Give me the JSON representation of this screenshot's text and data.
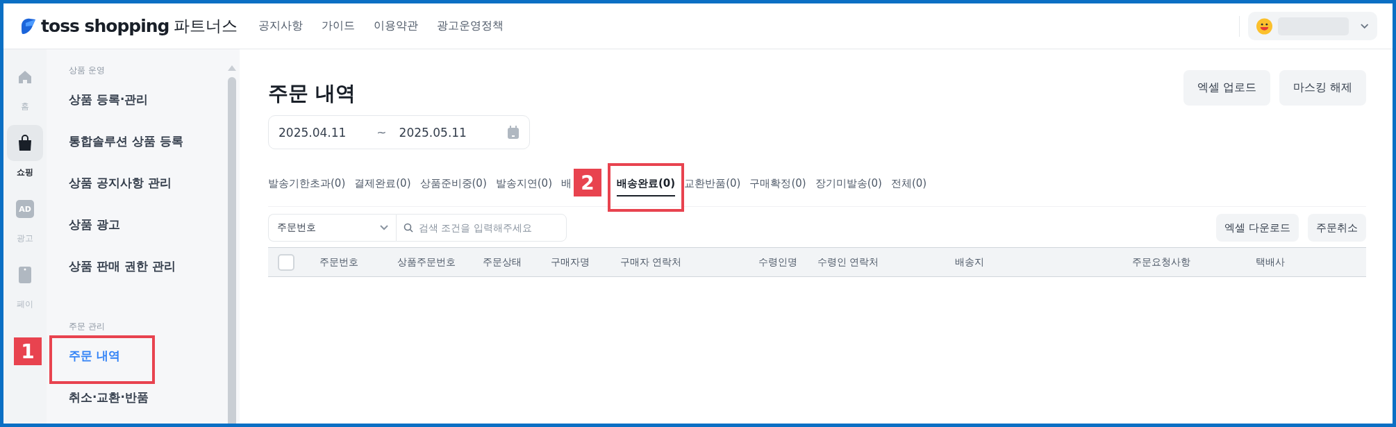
{
  "header": {
    "logo": "toss shopping",
    "logo_suffix": "파트너스",
    "nav": [
      "공지사항",
      "가이드",
      "이용약관",
      "광고운영정책"
    ]
  },
  "rail": [
    {
      "kind": "home",
      "label": "홈",
      "selected": false
    },
    {
      "kind": "bag",
      "label": "쇼핑",
      "selected": true
    },
    {
      "kind": "ad",
      "label": "광고",
      "icon_text": "AD",
      "selected": false
    },
    {
      "kind": "card",
      "label": "페이",
      "selected": false
    }
  ],
  "menu": [
    {
      "title": "상품 운영",
      "items": [
        {
          "label": "상품 등록·관리",
          "selected": false
        },
        {
          "label": "통합솔루션 상품 등록",
          "selected": false
        },
        {
          "label": "상품 공지사항 관리",
          "selected": false
        },
        {
          "label": "상품 광고",
          "selected": false
        },
        {
          "label": "상품 판매 권한 관리",
          "selected": false
        }
      ]
    },
    {
      "title": "주문 관리",
      "items": [
        {
          "label": "주문 내역",
          "selected": true,
          "callout": "1"
        },
        {
          "label": "취소·교환·반품",
          "selected": false
        }
      ]
    }
  ],
  "page": {
    "title": "주문 내역",
    "buttons": [
      "엑셀 업로드",
      "마스킹 해제"
    ],
    "date_from": "2025.04.11",
    "separator": "~",
    "date_to": "2025.05.11"
  },
  "tabs": [
    {
      "label": "발송기한초과(0)",
      "selected": false
    },
    {
      "label": "결제완료(0)",
      "selected": false
    },
    {
      "label": "상품준비중(0)",
      "selected": false
    },
    {
      "label": "발송지연(0)",
      "selected": false
    },
    {
      "label": "배",
      "selected": false
    },
    {
      "label": "배송완료(0)",
      "selected": true,
      "callout": "2"
    },
    {
      "label": "교환반품(0)",
      "selected": false
    },
    {
      "label": "구매확정(0)",
      "selected": false
    },
    {
      "label": "장기미발송(0)",
      "selected": false
    },
    {
      "label": "전체(0)",
      "selected": false
    }
  ],
  "search": {
    "filter": "주문번호",
    "placeholder": "검색 조건을 입력해주세요"
  },
  "table_actions": [
    "엑셀 다운로드",
    "주문취소"
  ],
  "table": {
    "select_all_checked": false,
    "columns": [
      "주문번호",
      "상품주문번호",
      "주문상태",
      "구매자명",
      "구매자 연락처",
      "수령인명",
      "수령인 연락처",
      "배송지",
      "주문요청사항",
      "택배사"
    ]
  }
}
